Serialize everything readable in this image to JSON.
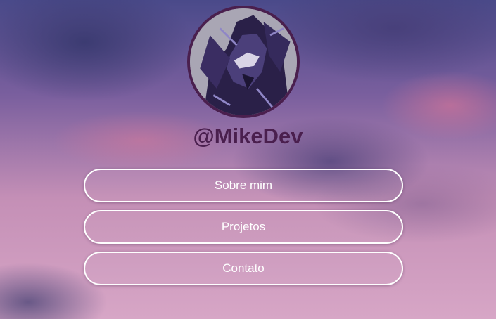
{
  "profile": {
    "avatar_icon": "anime-character-avatar-icon",
    "handle": "@MikeDev"
  },
  "links": [
    {
      "label": "Sobre mim"
    },
    {
      "label": "Projetos"
    },
    {
      "label": "Contato"
    }
  ],
  "colors": {
    "handle": "#4a1f4e",
    "button_border": "#ffffff",
    "button_text": "#ffffff",
    "avatar_ring": "#4a1f4e"
  }
}
